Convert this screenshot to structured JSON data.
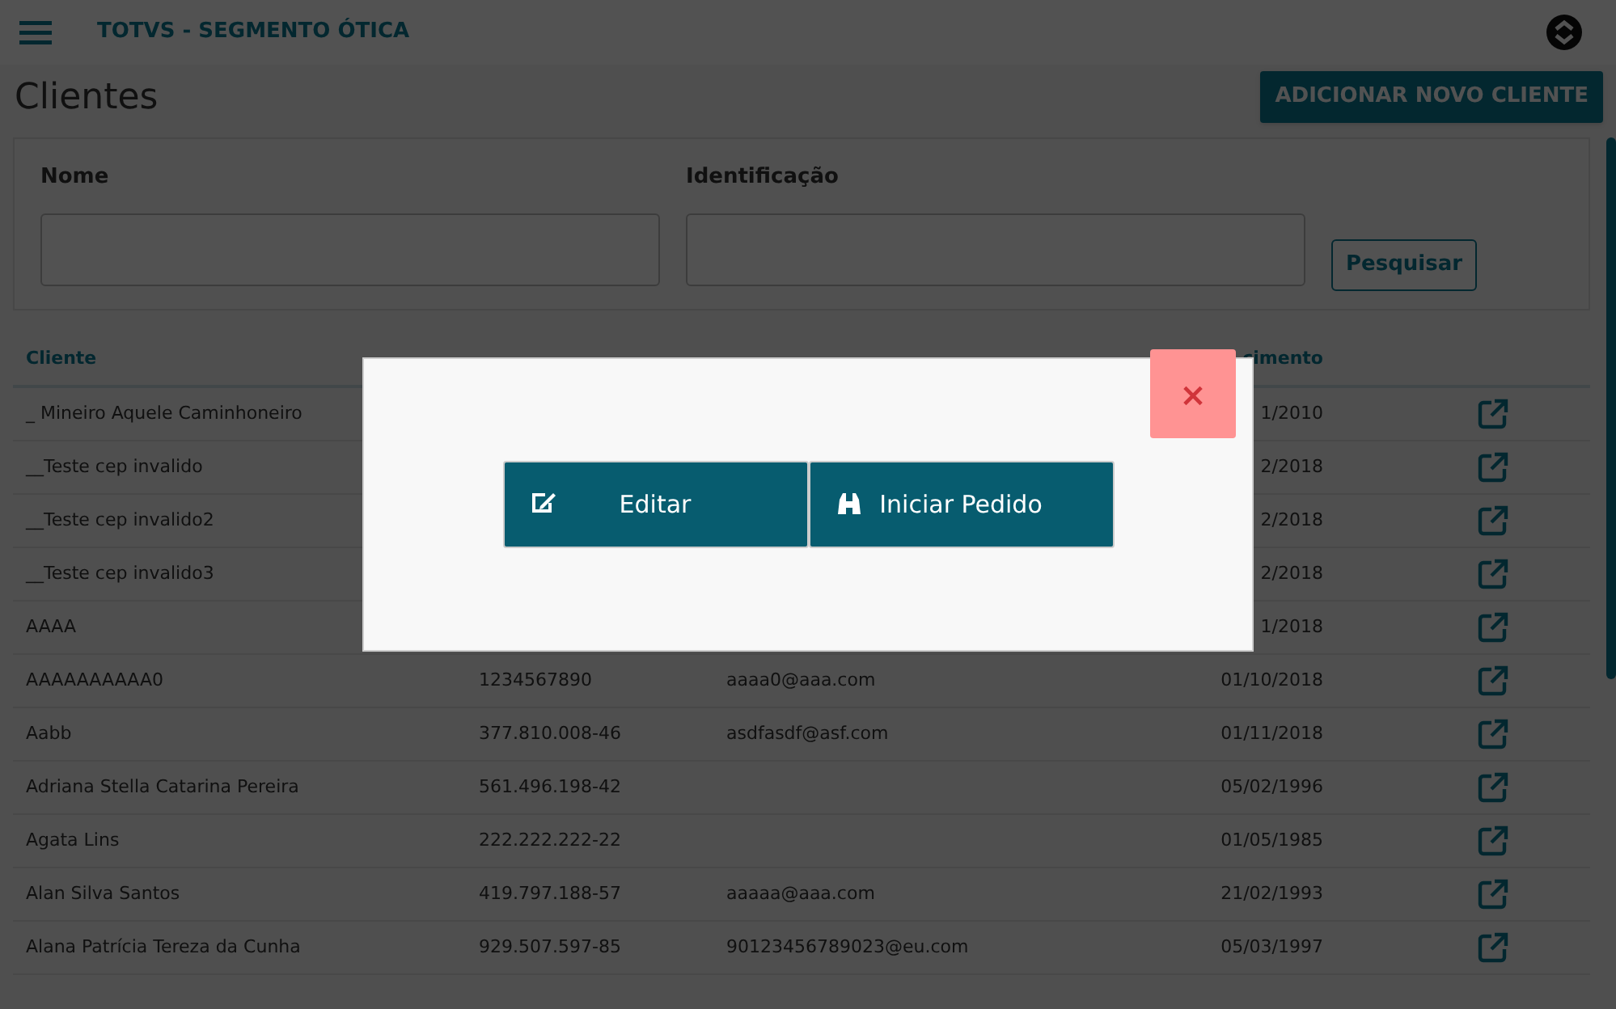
{
  "app_bar": {
    "title": "TOTVS - SEGMENTO ÓTICA"
  },
  "page": {
    "title": "Clientes",
    "add_button": "ADICIONAR NOVO CLIENTE"
  },
  "filters": {
    "fields": [
      {
        "label": "Nome"
      },
      {
        "label": "Identificação"
      }
    ],
    "search_button": "Pesquisar"
  },
  "table": {
    "columns": [
      "Cliente",
      "cimento"
    ],
    "rows": [
      {
        "client": "_ Mineiro Aquele Caminhoneiro",
        "date": "1/2010"
      },
      {
        "client": "__Teste cep invalido",
        "date": "2/2018"
      },
      {
        "client": "__Teste cep invalido2",
        "date": "2/2018"
      },
      {
        "client": "__Teste cep invalido3",
        "date": "2/2018"
      },
      {
        "client": "AAAA",
        "date": "1/2018"
      },
      {
        "client": "AAAAAAAAAA0",
        "id": "1234567890",
        "email": "aaaa0@aaa.com",
        "date": "01/10/2018"
      },
      {
        "client": "Aabb",
        "id": "377.810.008-46",
        "email": "asdfasdf@asf.com",
        "date": "01/11/2018"
      },
      {
        "client": "Adriana Stella Catarina Pereira",
        "id": "561.496.198-42",
        "date": "05/02/1996"
      },
      {
        "client": "Agata Lins",
        "id": "222.222.222-22",
        "date": "01/05/1985"
      },
      {
        "client": "Alan Silva Santos",
        "id": "419.797.188-57",
        "email": "aaaaa@aaa.com",
        "date": "21/02/1993"
      },
      {
        "client": "Alana Patrícia Tereza da Cunha",
        "id": "929.507.597-85",
        "email": "90123456789023@eu.com",
        "date": "05/03/1997"
      }
    ]
  },
  "modal": {
    "close": "×",
    "buttons": [
      {
        "label": "Editar",
        "kind": "edit"
      },
      {
        "label": "Iniciar Pedido",
        "kind": "binoculars"
      }
    ]
  }
}
